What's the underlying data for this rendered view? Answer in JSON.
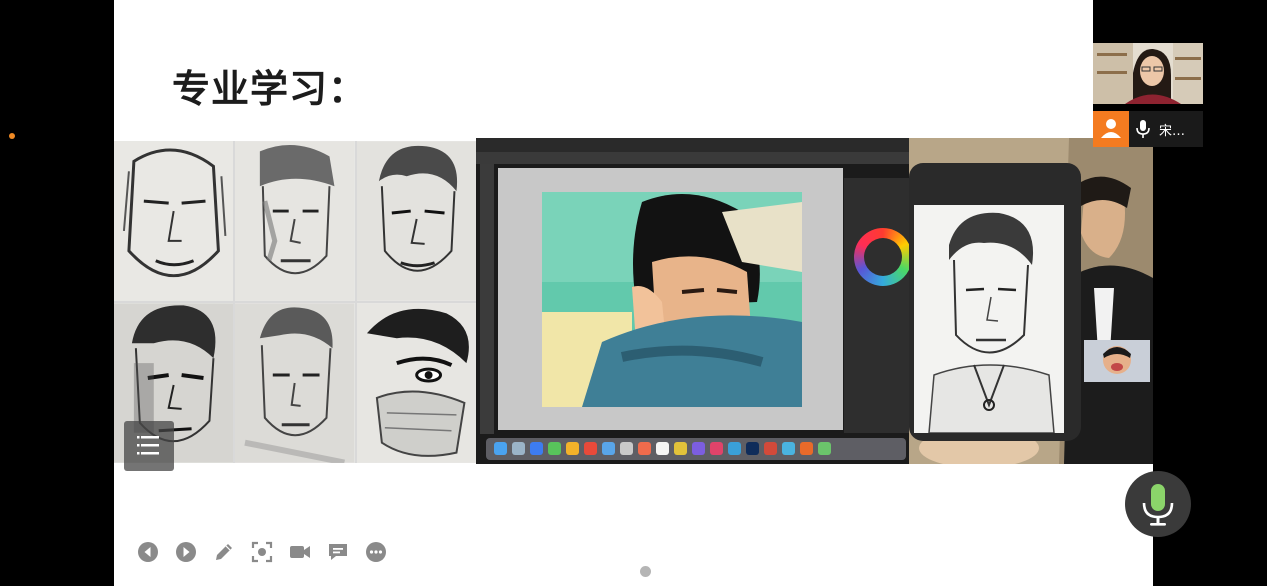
{
  "slide": {
    "title": "专业学习："
  },
  "images": {
    "sketch_grid": {
      "name": "pencil-portrait-sketches"
    },
    "monitor": {
      "name": "photoshop-digital-painting"
    },
    "tablet": {
      "name": "ipad-portrait-drawing"
    }
  },
  "participant": {
    "name": "宋…",
    "avatar_color": "#f47b20"
  },
  "toolbar": {
    "buttons": [
      "previous-icon",
      "next-icon",
      "pen-icon",
      "screenshot-icon",
      "camera-icon",
      "comment-icon",
      "more-icon"
    ]
  },
  "colors": {
    "background": "#000000",
    "slide": "#ffffff",
    "accent": "#f47b20",
    "mic_green": "#8bd46a"
  }
}
